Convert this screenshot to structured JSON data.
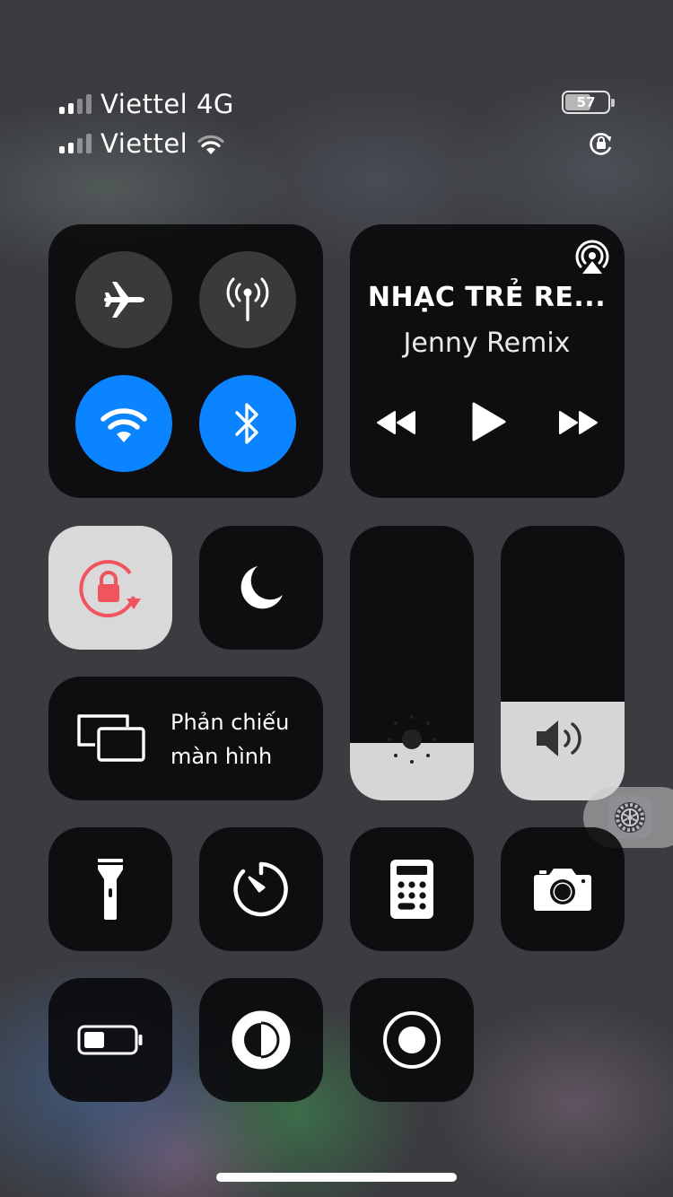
{
  "status_bar": {
    "carrier_1": "Viettel 4G",
    "carrier_2": "Viettel",
    "battery_level": "57",
    "icons": [
      "signal-icon",
      "wifi-icon",
      "rotation-lock-icon"
    ]
  },
  "connectivity": {
    "airplane": {
      "icon": "airplane-icon",
      "state": "off"
    },
    "cellular": {
      "icon": "antenna-icon",
      "state": "off"
    },
    "wifi": {
      "icon": "wifi-icon",
      "state": "on"
    },
    "bluetooth": {
      "icon": "bluetooth-icon",
      "state": "on"
    }
  },
  "music": {
    "title": "NHẠC TRẺ RE...",
    "artist": "Jenny Remix",
    "icons": [
      "airplay-icon",
      "rewind-icon",
      "play-icon",
      "fast-forward-icon"
    ]
  },
  "toggles": {
    "rotation_lock": {
      "icon": "rotation-lock-icon",
      "state": "on"
    },
    "do_not_disturb": {
      "icon": "moon-icon",
      "state": "off"
    }
  },
  "screen_mirroring": {
    "label_line1": "Phản chiếu",
    "label_line2": "màn hình"
  },
  "sliders": {
    "brightness_level": 0.21,
    "volume_level": 0.36
  },
  "shortcuts": [
    "flashlight-icon",
    "timer-icon",
    "calculator-icon",
    "camera-icon",
    "low-power-icon",
    "dark-mode-icon",
    "screen-record-icon"
  ],
  "colors": {
    "accent_blue": "#0a84ff",
    "rotation_lock_red": "#f0545c"
  }
}
